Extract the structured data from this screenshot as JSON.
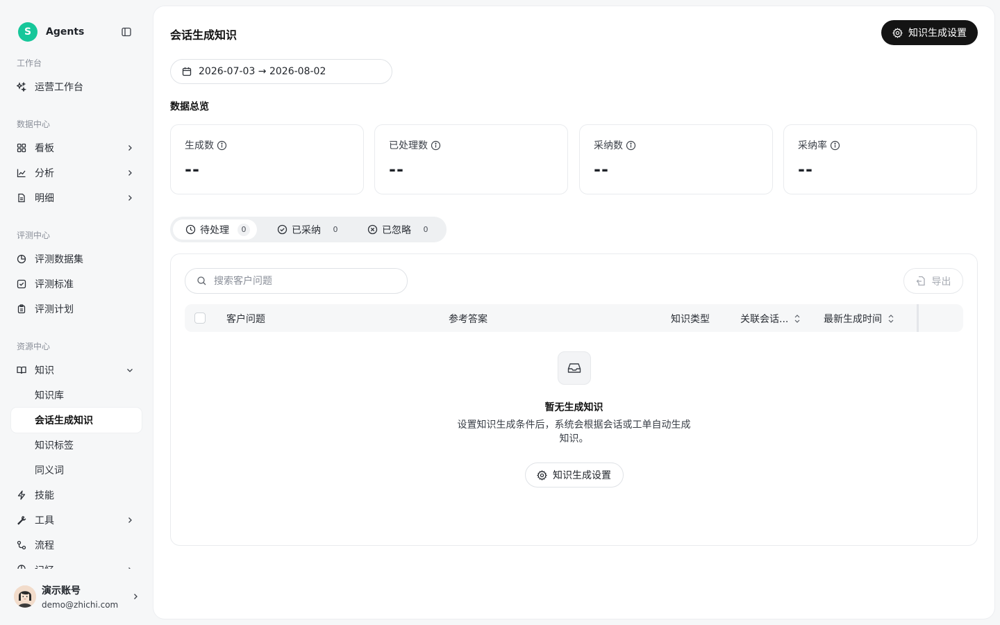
{
  "app": {
    "logo_letter": "S",
    "name": "Agents"
  },
  "sidebar": {
    "sections": {
      "workbench": "工作台",
      "data_center": "数据中心",
      "eval_center": "评测中心",
      "resource_center": "资源中心"
    },
    "items": {
      "ops_workbench": "运营工作台",
      "dashboard": "看板",
      "analysis": "分析",
      "detail": "明细",
      "eval_dataset": "评测数据集",
      "eval_standard": "评测标准",
      "eval_plan": "评测计划",
      "knowledge": "知识",
      "knowledge_base": "知识库",
      "session_knowledge": "会话生成知识",
      "knowledge_tags": "知识标签",
      "synonyms": "同义词",
      "skills": "技能",
      "tools": "工具",
      "flows": "流程",
      "memory": "记忆"
    },
    "user": {
      "name": "演示账号",
      "email": "demo@zhichi.com"
    }
  },
  "main": {
    "title": "会话生成知识",
    "settings_button": "知识生成设置",
    "date_range": "2026-07-03 → 2026-08-02",
    "overview_title": "数据总览",
    "stats": [
      {
        "label": "生成数",
        "value": "--"
      },
      {
        "label": "已处理数",
        "value": "--"
      },
      {
        "label": "采纳数",
        "value": "--"
      },
      {
        "label": "采纳率",
        "value": "--"
      }
    ],
    "tabs": [
      {
        "label": "待处理",
        "count": "0"
      },
      {
        "label": "已采纳",
        "count": "0"
      },
      {
        "label": "已忽略",
        "count": "0"
      }
    ],
    "search": {
      "placeholder": "搜索客户问题",
      "value": ""
    },
    "export_button": "导出",
    "columns": {
      "question": "客户问题",
      "answer": "参考答案",
      "type": "知识类型",
      "related": "关联会话...",
      "latest_time": "最新生成时间"
    },
    "empty": {
      "title": "暂无生成知识",
      "description": "设置知识生成条件后，系统会根据会话或工单自动生成知识。",
      "button": "知识生成设置"
    }
  },
  "colors": {
    "brand": "#16c79a",
    "primary_button": "#141414"
  }
}
